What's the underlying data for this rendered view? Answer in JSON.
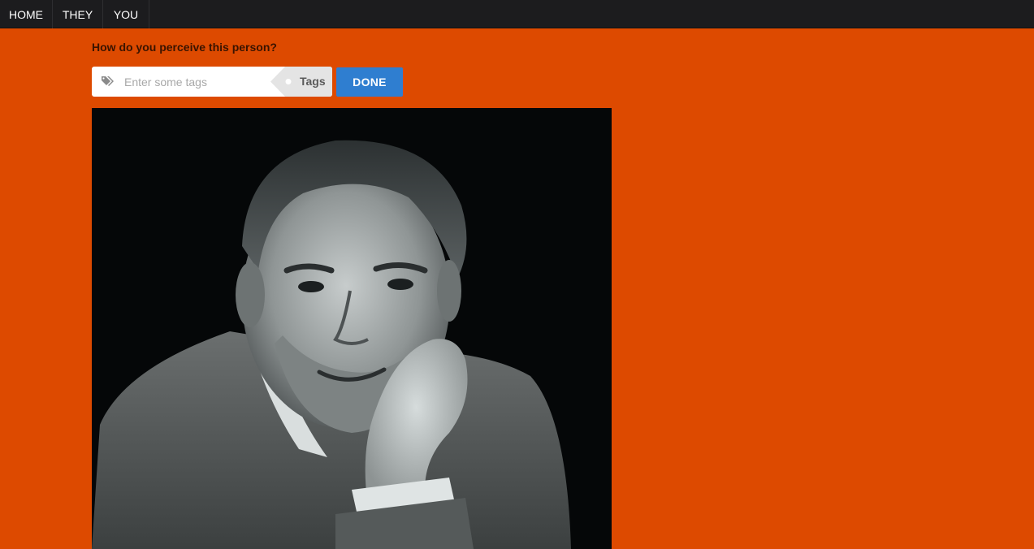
{
  "nav": {
    "items": [
      {
        "label": "HOME"
      },
      {
        "label": "THEY"
      },
      {
        "label": "YOU"
      }
    ]
  },
  "question": {
    "text": "How do you perceive this person?"
  },
  "tag_input": {
    "placeholder": "Enter some tags",
    "value": "",
    "icon": "tags-icon",
    "label": "Tags"
  },
  "done_button": {
    "label": "DONE"
  },
  "photo": {
    "alt": "portrait",
    "background": "#050708"
  },
  "colors": {
    "page_background": "#dd4a00",
    "nav_background": "#1c1c1e",
    "button_blue": "#2f7ed0",
    "question_text": "#3a1400"
  }
}
